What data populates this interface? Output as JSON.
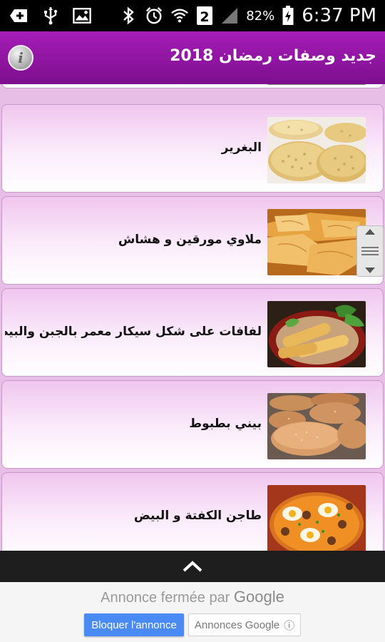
{
  "status_bar": {
    "battery_text": "82%",
    "time": "6:37 PM",
    "icons": [
      "add-notification-icon",
      "usb-icon",
      "image-icon",
      "bluetooth-icon",
      "alarm-icon",
      "wifi-icon",
      "sim-2-icon",
      "signal-icon",
      "battery-charging-icon"
    ],
    "sim_label": "2"
  },
  "app_bar": {
    "title": "جديد وصفات رمضان 2018",
    "info_label": "i",
    "background": "#8f17a3"
  },
  "list": {
    "items": [
      {
        "title": "البغرير",
        "image": "baghrir-photo"
      },
      {
        "title": "ملاوي مورقين و هشاش",
        "image": "msemen-photo"
      },
      {
        "title": "لفافات على شكل سيكار معمر بالجبن والبيض",
        "image": "cigars-photo"
      },
      {
        "title": "بيني بطبوط",
        "image": "batbout-photo"
      },
      {
        "title": "طاجن الكفتة و البيض",
        "image": "kefta-tajine-photo"
      }
    ]
  },
  "ad": {
    "closed_text": "Annonce fermée par",
    "google_word": "Google",
    "block_button": "Bloquer l'annonce",
    "google_ads_button": "Annonces Google",
    "info_glyph": "ⓘ"
  }
}
